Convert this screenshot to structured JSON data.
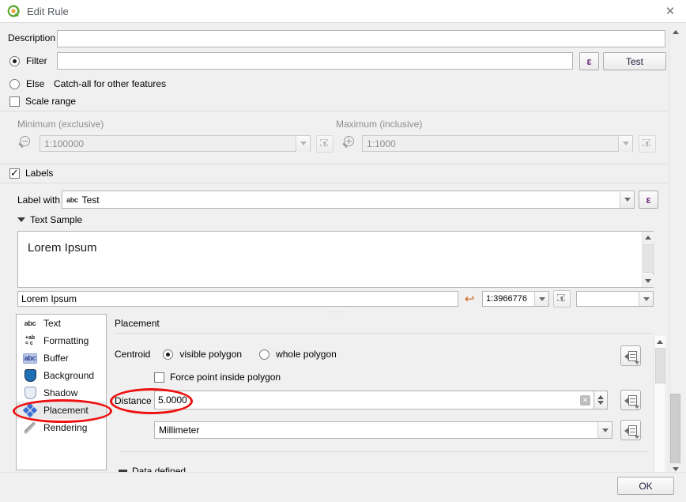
{
  "window": {
    "title": "Edit Rule",
    "app_icon": "qgis-icon",
    "close_label": "✕"
  },
  "description": {
    "label": "Description",
    "value": "",
    "placeholder": ""
  },
  "filter": {
    "label": "Filter",
    "selected": true,
    "value": "",
    "expression_button": "ε",
    "test_button": "Test"
  },
  "else_option": {
    "label": "Else",
    "hint": "Catch-all for other features",
    "selected": false
  },
  "scale_range": {
    "label": "Scale range",
    "checked": false,
    "minimum_label": "Minimum (exclusive)",
    "minimum_value": "1:100000",
    "maximum_label": "Maximum (inclusive)",
    "maximum_value": "1:1000"
  },
  "labels": {
    "label": "Labels",
    "checked": true,
    "label_with_label": "Label with",
    "label_with_value": "Test",
    "label_with_prefix_icon": "abc",
    "expression_button": "ε"
  },
  "text_sample": {
    "section_title": "Text Sample",
    "collapsed": false,
    "preview_text": "Lorem Ipsum",
    "input_value": "Lorem Ipsum",
    "revert_icon": "revert-arrow-icon",
    "scale_value": "1:3966776",
    "pick_icon": "select-on-canvas-icon",
    "extra_value": ""
  },
  "sidebar": {
    "items": [
      {
        "label": "Text",
        "icon": "text-abc-icon",
        "selected": false
      },
      {
        "label": "Formatting",
        "icon": "formatting-icon",
        "selected": false
      },
      {
        "label": "Buffer",
        "icon": "buffer-abc-icon",
        "selected": false
      },
      {
        "label": "Background",
        "icon": "background-shield-icon",
        "selected": false
      },
      {
        "label": "Shadow",
        "icon": "shadow-shield-icon",
        "selected": false
      },
      {
        "label": "Placement",
        "icon": "placement-move-icon",
        "selected": true
      },
      {
        "label": "Rendering",
        "icon": "rendering-pen-icon",
        "selected": false
      }
    ]
  },
  "placement": {
    "title": "Placement",
    "centroid_label": "Centroid",
    "centroid_options": [
      {
        "label": "visible polygon",
        "selected": true
      },
      {
        "label": "whole polygon",
        "selected": false
      }
    ],
    "force_point_label": "Force point inside polygon",
    "force_point_checked": false,
    "distance_label": "Distance",
    "distance_value": "5.0000",
    "distance_clear_icon": "clear-icon",
    "unit_value": "Millimeter",
    "data_defined_label": "Data defined",
    "override_button_icon": "data-defined-override-icon"
  },
  "footer": {
    "ok_button": "OK"
  },
  "annotations": {
    "circle_placement": "red-ellipse-around-placement",
    "circle_distance": "red-ellipse-around-distance"
  },
  "colors": {
    "accent_red": "#ee1111",
    "expression_purple": "#6b2d7a",
    "qgis_green": "#5aa832",
    "qgis_orange": "#e8a33d",
    "dialog_bg": "#f0f0f0",
    "field_bg": "#ffffff"
  }
}
